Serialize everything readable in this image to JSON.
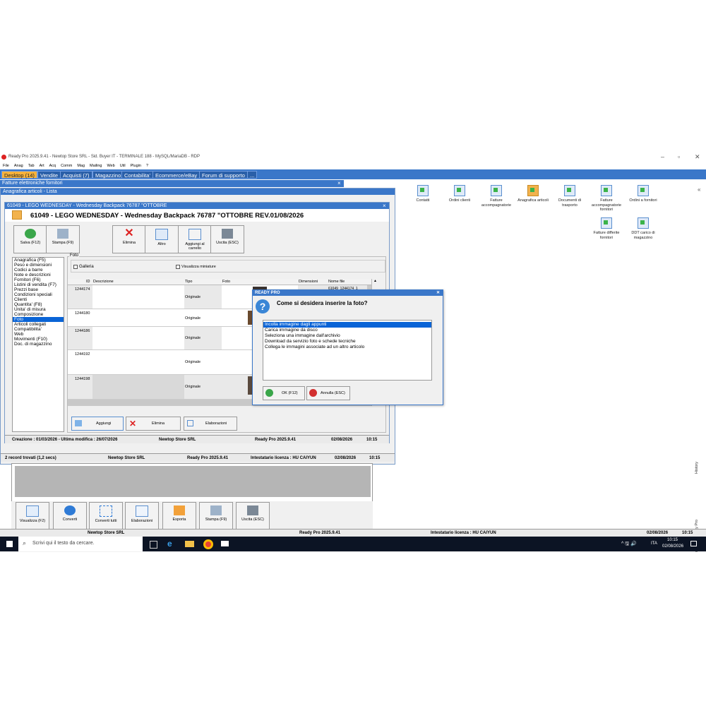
{
  "window": {
    "title": "Ready Pro 2025.9.41 - Newtop Store SRL - Sid. Buyer IT - TERMINALE 188 - MySQL/MariaDB - RDP",
    "minimize": "–",
    "maximize": "▫",
    "close": "✕"
  },
  "menu": [
    "File",
    "Anag",
    "Tab",
    "Art",
    "Acq",
    "Comm",
    "Mag",
    "Mailing",
    "Web",
    "Util",
    "Plugin",
    "?"
  ],
  "tabs": [
    "Desktop (14)",
    "Vendite",
    "Acquisti (7)",
    "Magazzino",
    "Contabilita'",
    "Ecommerce/eBay",
    "Forum di supporto",
    "..."
  ],
  "desktop_icons": [
    "Contatti",
    "Ordini clienti",
    "Fatture accompagnatorie",
    "Anagrafica articoli",
    "Documenti di trasporto",
    "Fatture accompagnatorie fornitori",
    "Ordini a fornitori",
    "Fatture differite fornitori",
    "DDT carico di magazzino"
  ],
  "side_collapse": "«",
  "side_vertical": [
    "Assistente Ready Pro",
    "History"
  ],
  "fatture_window": {
    "title": "Fatture elettroniche fornitori",
    "close": "×"
  },
  "anagrafica_list": {
    "title": "Anagrafica articoli - Lista",
    "status": [
      "2 record trovati (1,2 secs)",
      "Newtop Store SRL",
      "Ready Pro 2025.9.41",
      "Intestatario licenza : HU CAIYUN",
      "02/08/2026",
      "10:15"
    ],
    "toolbar": [
      "Visualizza (F2)",
      "Converti",
      "Converti tutti",
      "Elaborazioni",
      "Esporta",
      "Stampa (F9)",
      "Uscita (ESC)"
    ],
    "scroll_left": "◂",
    "scroll_right": "▸"
  },
  "article": {
    "window_title": "61049 - LEGO WEDNESDAY - Wednesday Backpack 76787 \"OTTOBRE",
    "header": "61049 - LEGO WEDNESDAY - Wednesday Backpack 76787 \"OTTOBRE REV.01/08/2026",
    "close": "×",
    "toolbar": [
      "Salva (F12)",
      "Stampa (F9)",
      "Elimina",
      "Altro",
      "Aggiungi al carrello",
      "Uscita (ESC)"
    ],
    "nav": [
      "Anagrafica (F5)",
      "Peso e dimensioni",
      "Codici a barre",
      "Note e descrizioni",
      "Fornitori (F6)",
      "Listini di vendita (F7)",
      "Prezzi base",
      "Condizioni speciali",
      "Clienti",
      "Quantita' (F8)",
      "Unita' di misura",
      "Composizione",
      "Foto",
      "Articoli collegati",
      "Compatibilita'",
      "Web",
      "Movimenti (F10)",
      "Doc. di magazzino"
    ],
    "nav_selected": 12,
    "foto_group": "Foto",
    "galleria": "Galleria",
    "miniature": "Visualizza miniature",
    "columns": [
      "ID",
      "Descrizione",
      "Tipo",
      "Foto",
      "Dimensioni",
      "Nome file"
    ],
    "rows": [
      {
        "id": "1244174",
        "tipo": "Originale",
        "file": "61049_1244174_1 8814232398.BMP.P"
      },
      {
        "id": "1244180",
        "tipo": "Originale",
        "file": ""
      },
      {
        "id": "1244186",
        "tipo": "Originale",
        "file": ""
      },
      {
        "id": "1244192",
        "tipo": "Originale",
        "file": ""
      },
      {
        "id": "1244198",
        "tipo": "Originale",
        "file": ""
      }
    ],
    "buttons": [
      "Aggiungi",
      "Elimina",
      "Elaborazioni"
    ],
    "status": [
      "Creazione : 01/03/2026 - Ultima modifica : 26/07/2026",
      "Newtop Store SRL",
      "Ready Pro 2025.9.41",
      "02/08/2026",
      "10:15"
    ]
  },
  "dialog": {
    "title": "READY PRO",
    "close": "✕",
    "question": "Come si desidera inserire la foto?",
    "question_mark": "?",
    "options": [
      "Incolla immagine dagli appunti",
      "Carica immagine da disco",
      "Seleziona una immagine dall'archivio",
      "Download da servizio foto e schede tecniche",
      "Collega le immagini associate ad un altro articolo"
    ],
    "selected": 0,
    "ok": "OK (F12)",
    "cancel": "Annulla (ESC)"
  },
  "bottom_status": [
    "Newtop Store SRL",
    "Ready Pro 2025.9.41",
    "Intestatario licenza : HU CAIYUN",
    "02/08/2026",
    "10:15"
  ],
  "taskbar": {
    "search_placeholder": "Scrivi qui il testo da cercare.",
    "lang": "ITA",
    "time": "10:15",
    "date": "02/08/2026",
    "tray": "^ 🖫 🔊"
  }
}
